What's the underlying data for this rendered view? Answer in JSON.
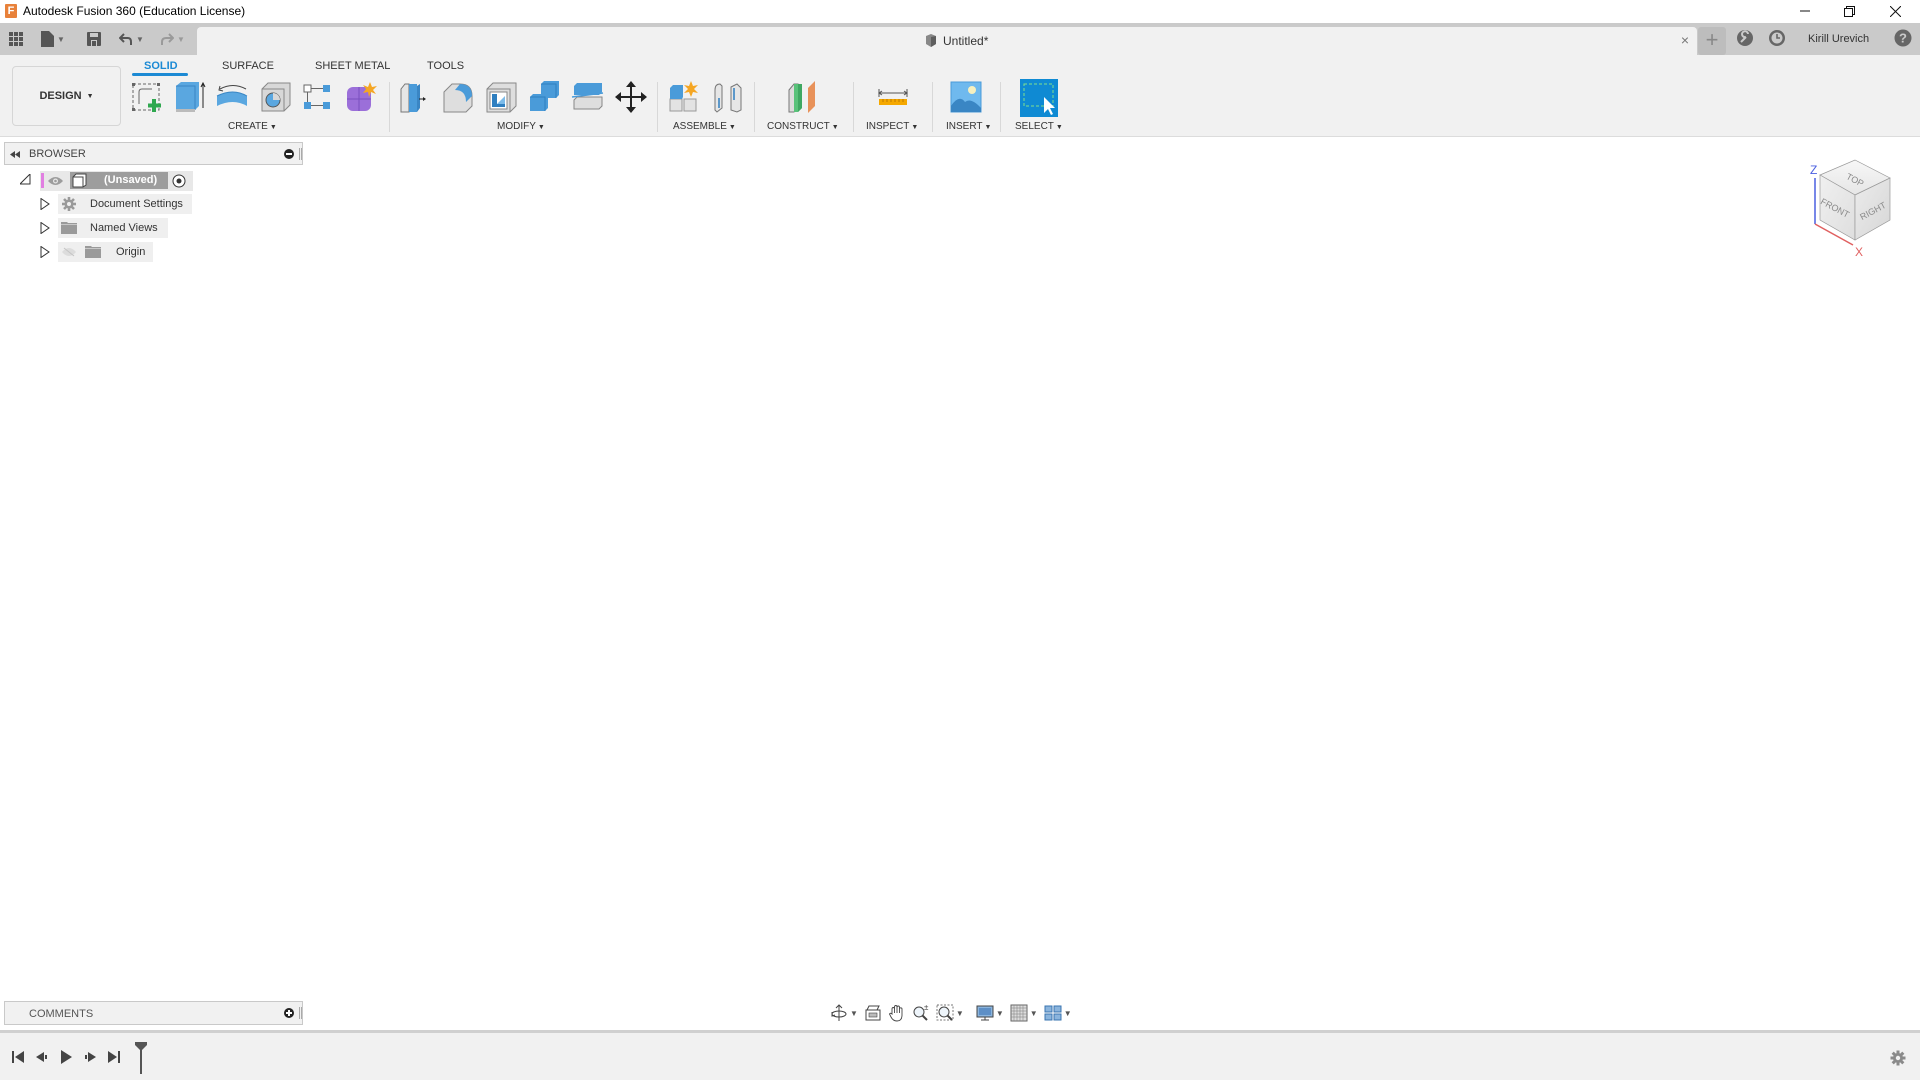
{
  "window": {
    "title": "Autodesk Fusion 360 (Education License)",
    "logo_letter": "F",
    "controls": [
      "minimize",
      "restore",
      "close"
    ]
  },
  "header": {
    "document_tab": {
      "title": "Untitled*",
      "close_glyph": "×"
    },
    "new_tab_glyph": "+",
    "user_name": "Kirill Urevich",
    "icons": [
      "apps-grid-icon",
      "file-icon",
      "save-icon",
      "undo-icon",
      "redo-icon",
      "extensions-icon",
      "job-status-icon",
      "help-icon"
    ]
  },
  "toolbar": {
    "workspace": "DESIGN",
    "tabs": [
      {
        "label": "SOLID",
        "active": true
      },
      {
        "label": "SURFACE",
        "active": false
      },
      {
        "label": "SHEET METAL",
        "active": false
      },
      {
        "label": "TOOLS",
        "active": false
      }
    ],
    "groups": [
      {
        "label": "CREATE",
        "tools": [
          "Create Sketch",
          "Extrude",
          "Revolve",
          "Hole",
          "Pattern",
          "Create Form"
        ]
      },
      {
        "label": "MODIFY",
        "tools": [
          "Press Pull",
          "Fillet",
          "Shell",
          "Combine",
          "Split Body",
          "Move/Copy"
        ]
      },
      {
        "label": "ASSEMBLE",
        "tools": [
          "New Component",
          "Joint"
        ]
      },
      {
        "label": "CONSTRUCT",
        "tools": [
          "Offset Plane"
        ]
      },
      {
        "label": "INSPECT",
        "tools": [
          "Measure"
        ]
      },
      {
        "label": "INSERT",
        "tools": [
          "Insert Canvas"
        ]
      },
      {
        "label": "SELECT",
        "tools": [
          "Select"
        ]
      }
    ],
    "accent_color": "#1c8ad4"
  },
  "browser": {
    "title": "BROWSER",
    "root": {
      "label": "(Unsaved)"
    },
    "items": [
      {
        "label": "Document Settings",
        "icon": "gear-icon"
      },
      {
        "label": "Named Views",
        "icon": "folder-icon"
      },
      {
        "label": "Origin",
        "icon": "folder-icon",
        "hidden": true
      }
    ]
  },
  "viewcube": {
    "faces": {
      "top": "TOP",
      "front": "FRONT",
      "right": "RIGHT"
    },
    "axes": {
      "z": "Z",
      "x": "X"
    }
  },
  "comments": {
    "title": "COMMENTS"
  },
  "navbar": {
    "tools": [
      "orbit",
      "look-at",
      "pan",
      "zoom",
      "fit",
      "display-settings",
      "grid-snaps",
      "viewports"
    ]
  },
  "timeline": {
    "controls": [
      "go-to-start",
      "step-back",
      "play",
      "step-forward",
      "go-to-end"
    ]
  }
}
